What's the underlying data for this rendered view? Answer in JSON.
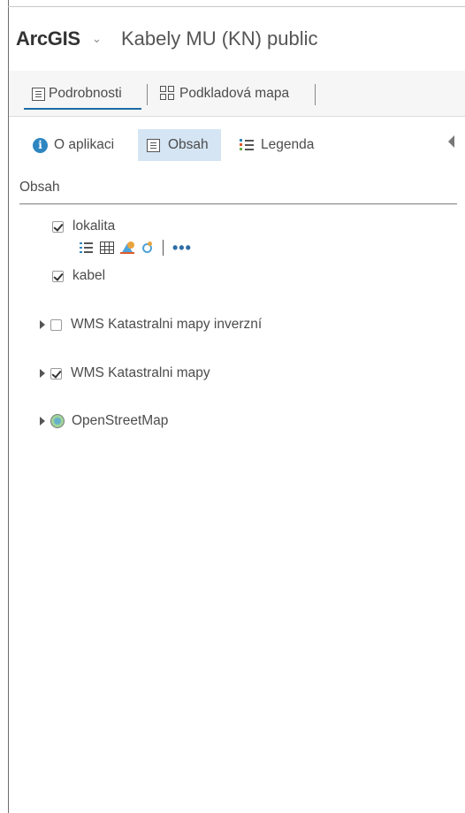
{
  "header": {
    "brand": "ArcGIS",
    "caret": "⌄",
    "title": "Kabely MU (KN) public"
  },
  "tabs": [
    {
      "label": "Podrobnosti",
      "active": true
    },
    {
      "label": "Podkladová mapa",
      "active": false
    }
  ],
  "subnav": {
    "about": "O aplikaci",
    "content": "Obsah",
    "legend": "Legenda"
  },
  "content": {
    "section_title": "Obsah",
    "layers": [
      {
        "name": "lokalita",
        "checked": true
      },
      {
        "name": "kabel",
        "checked": true
      },
      {
        "name": "WMS Katastralni mapy inverzní",
        "checked": false
      },
      {
        "name": "WMS Katastralni mapy",
        "checked": true
      },
      {
        "name": "OpenStreetMap",
        "type": "basemap"
      }
    ],
    "more_label": "•••"
  },
  "colors": {
    "accent": "#1d6ca3",
    "active_bg": "#d5e5f3",
    "info": "#2e86c1"
  }
}
